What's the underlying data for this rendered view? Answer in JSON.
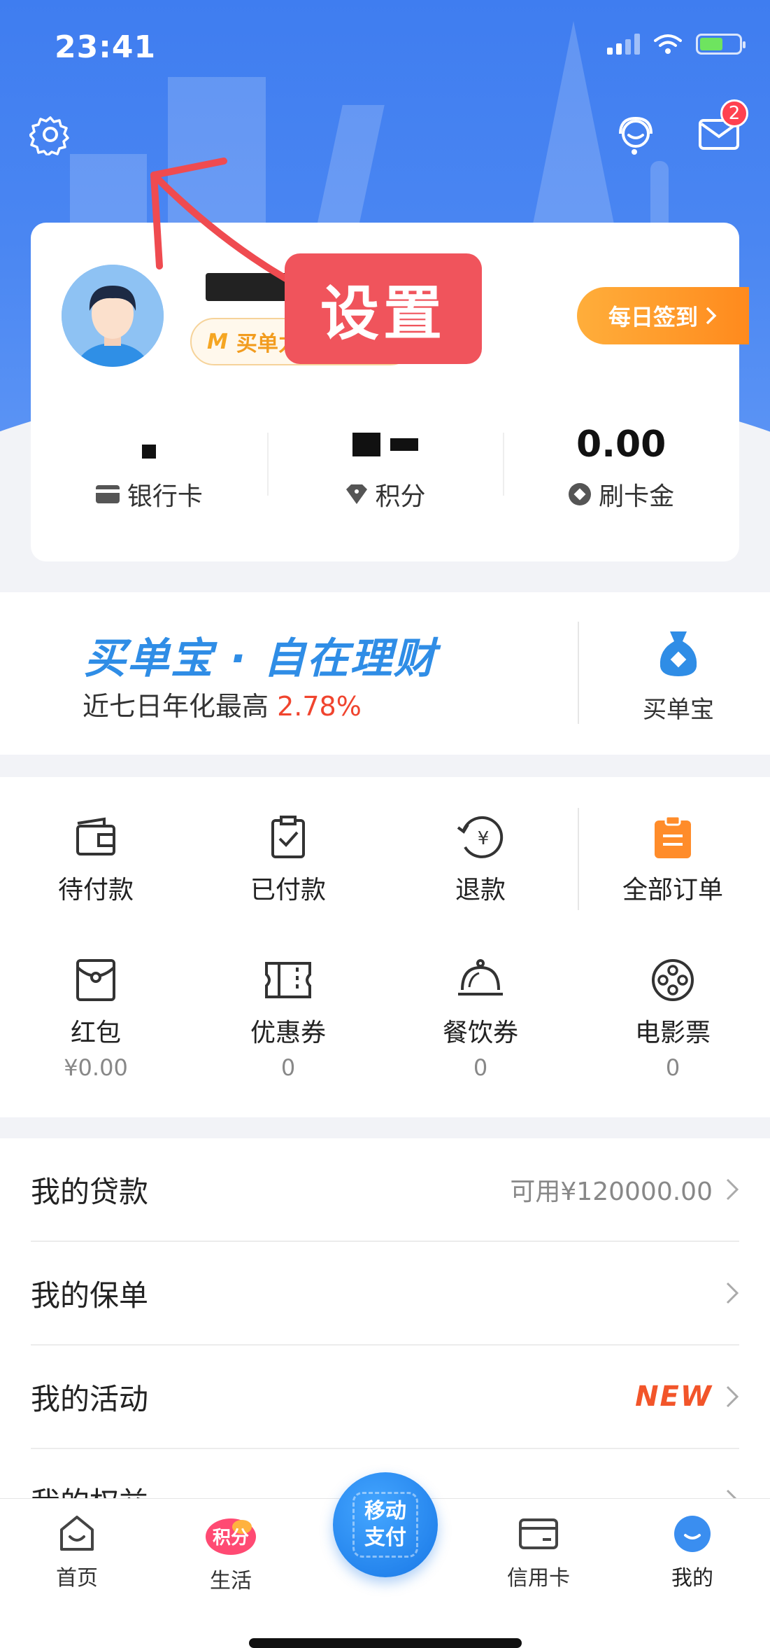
{
  "status_bar": {
    "time": "23:41"
  },
  "header": {
    "message_badge": "2"
  },
  "annotation": {
    "label": "设置"
  },
  "profile": {
    "level_label": "买单力",
    "checkin_label": "每日签到",
    "stats": [
      {
        "label": "银行卡",
        "value": "",
        "icon": "card-icon"
      },
      {
        "label": "积分",
        "value": "",
        "icon": "diamond-icon"
      },
      {
        "label": "刷卡金",
        "value": "0.00",
        "icon": "coin-icon"
      }
    ]
  },
  "wealth": {
    "title": "买单宝 · 自在理财",
    "subtitle": "近七日年化最高",
    "rate": "2.78%",
    "side_label": "买单宝"
  },
  "orders": [
    {
      "label": "待付款",
      "icon": "wallet-icon"
    },
    {
      "label": "已付款",
      "icon": "clipboard-check-icon"
    },
    {
      "label": "退款",
      "icon": "refund-icon"
    },
    {
      "label": "全部订单",
      "icon": "order-list-icon"
    }
  ],
  "assets": [
    {
      "label": "红包",
      "value": "¥0.00",
      "icon": "red-envelope-icon"
    },
    {
      "label": "优惠券",
      "value": "0",
      "icon": "coupon-icon"
    },
    {
      "label": "餐饮券",
      "value": "0",
      "icon": "dining-icon"
    },
    {
      "label": "电影票",
      "value": "0",
      "icon": "film-icon"
    }
  ],
  "list": [
    {
      "title": "我的贷款",
      "right": "可用¥120000.00"
    },
    {
      "title": "我的保单",
      "right": ""
    },
    {
      "title": "我的活动",
      "right": "NEW"
    },
    {
      "title": "我的权益",
      "right": ""
    }
  ],
  "tabbar": {
    "tabs": [
      {
        "label": "首页",
        "icon": "home-icon"
      },
      {
        "label": "生活",
        "icon": "points-icon",
        "icon_text": "积分"
      },
      {
        "label": "信用卡",
        "icon": "credit-card-icon"
      },
      {
        "label": "我的",
        "icon": "profile-icon"
      }
    ],
    "center": {
      "line1": "移动",
      "line2": "支付"
    }
  },
  "colors": {
    "primary": "#3f7df0",
    "accent_orange": "#ff8a1d",
    "rate_red": "#f0442e",
    "callout": "#f0545c"
  }
}
